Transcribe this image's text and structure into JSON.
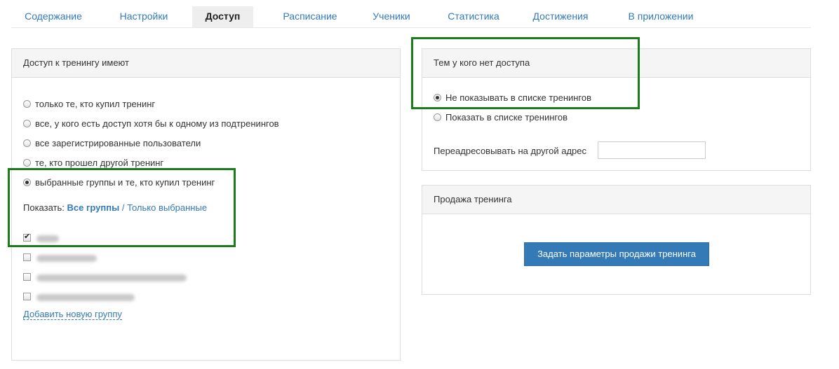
{
  "tabs": [
    {
      "label": "Содержание",
      "active": false
    },
    {
      "label": "Настройки",
      "active": false
    },
    {
      "label": "Доступ",
      "active": true
    },
    {
      "label": "Расписание",
      "active": false
    },
    {
      "label": "Ученики",
      "active": false
    },
    {
      "label": "Статистика",
      "active": false
    },
    {
      "label": "Достижения",
      "active": false
    },
    {
      "label": "В приложении",
      "active": false
    }
  ],
  "access_panel": {
    "title": "Доступ к тренингу имеют",
    "options": [
      {
        "label": "только те, кто купил тренинг",
        "selected": false
      },
      {
        "label": "все, у кого есть доступ хотя бы к одному из подтренингов",
        "selected": false
      },
      {
        "label": "все зарегистрированные пользователи",
        "selected": false
      },
      {
        "label": "те, кто прошел другой тренинг",
        "selected": false
      },
      {
        "label": "выбранные группы и те, кто купил тренинг",
        "selected": true
      }
    ],
    "show_label": "Показать:",
    "show_all": "Все группы",
    "show_separator": "/",
    "show_selected": "Только выбранные",
    "groups": [
      {
        "checked": true
      },
      {
        "checked": false
      },
      {
        "checked": false
      },
      {
        "checked": false
      }
    ],
    "add_group": "Добавить новую группу"
  },
  "no_access_panel": {
    "title": "Тем у кого нет доступа",
    "options": [
      {
        "label": "Не показывать в списке тренингов",
        "selected": true
      },
      {
        "label": "Показать в списке тренингов",
        "selected": false
      }
    ],
    "redirect_label": "Переадресовывать на другой адрес",
    "redirect_value": ""
  },
  "sale_panel": {
    "title": "Продажа тренинга",
    "button": "Задать параметры продажи тренинга"
  },
  "colors": {
    "link": "#337ab7",
    "primary": "#337ab7",
    "highlight": "#1a7d1a"
  }
}
